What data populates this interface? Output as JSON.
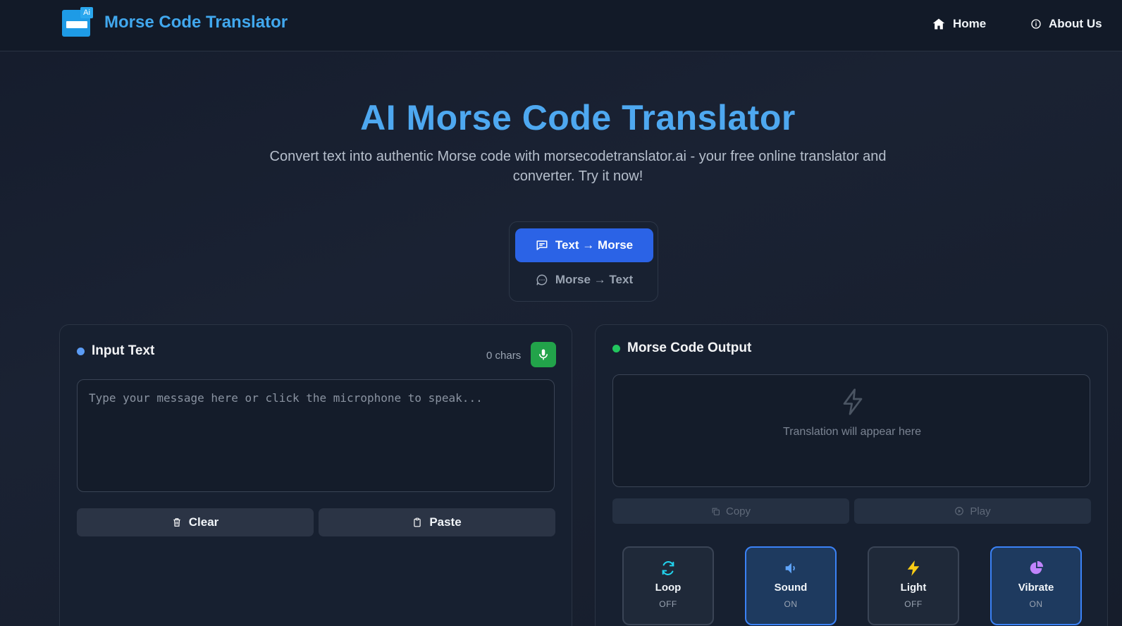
{
  "header": {
    "brand": "Morse Code Translator",
    "logo_badge": "Ai",
    "nav": [
      {
        "label": "Home",
        "icon": "home-icon"
      },
      {
        "label": "About Us",
        "icon": "info-icon"
      }
    ]
  },
  "hero": {
    "title": "AI Morse Code Translator",
    "subtitle": "Convert text into authentic Morse code with morsecodetranslator.ai - your free online translator and converter. Try it now!"
  },
  "mode": {
    "active": "Text → Morse",
    "inactive": "Morse → Text"
  },
  "input_panel": {
    "title": "Input Text",
    "char_count": "0 chars",
    "placeholder": "Type your message here or click the microphone to speak...",
    "value": "",
    "clear_label": "Clear",
    "paste_label": "Paste"
  },
  "output_panel": {
    "title": "Morse Code Output",
    "placeholder": "Translation will appear here",
    "copy_label": "Copy",
    "play_label": "Play",
    "options": [
      {
        "label": "Loop",
        "state": "OFF",
        "icon": "loop-icon",
        "color": "#22d3ee"
      },
      {
        "label": "Sound",
        "state": "ON",
        "icon": "sound-icon",
        "color": "#60a5fa"
      },
      {
        "label": "Light",
        "state": "OFF",
        "icon": "bolt-icon",
        "color": "#facc15"
      },
      {
        "label": "Vibrate",
        "state": "ON",
        "icon": "vibrate-icon",
        "color": "#c084fc"
      }
    ]
  },
  "colors": {
    "accent": "#2b63e6",
    "brand": "#41a8ee",
    "mic": "#22a34a",
    "input_dot": "#5b9cf5",
    "output_dot": "#22c55e"
  }
}
